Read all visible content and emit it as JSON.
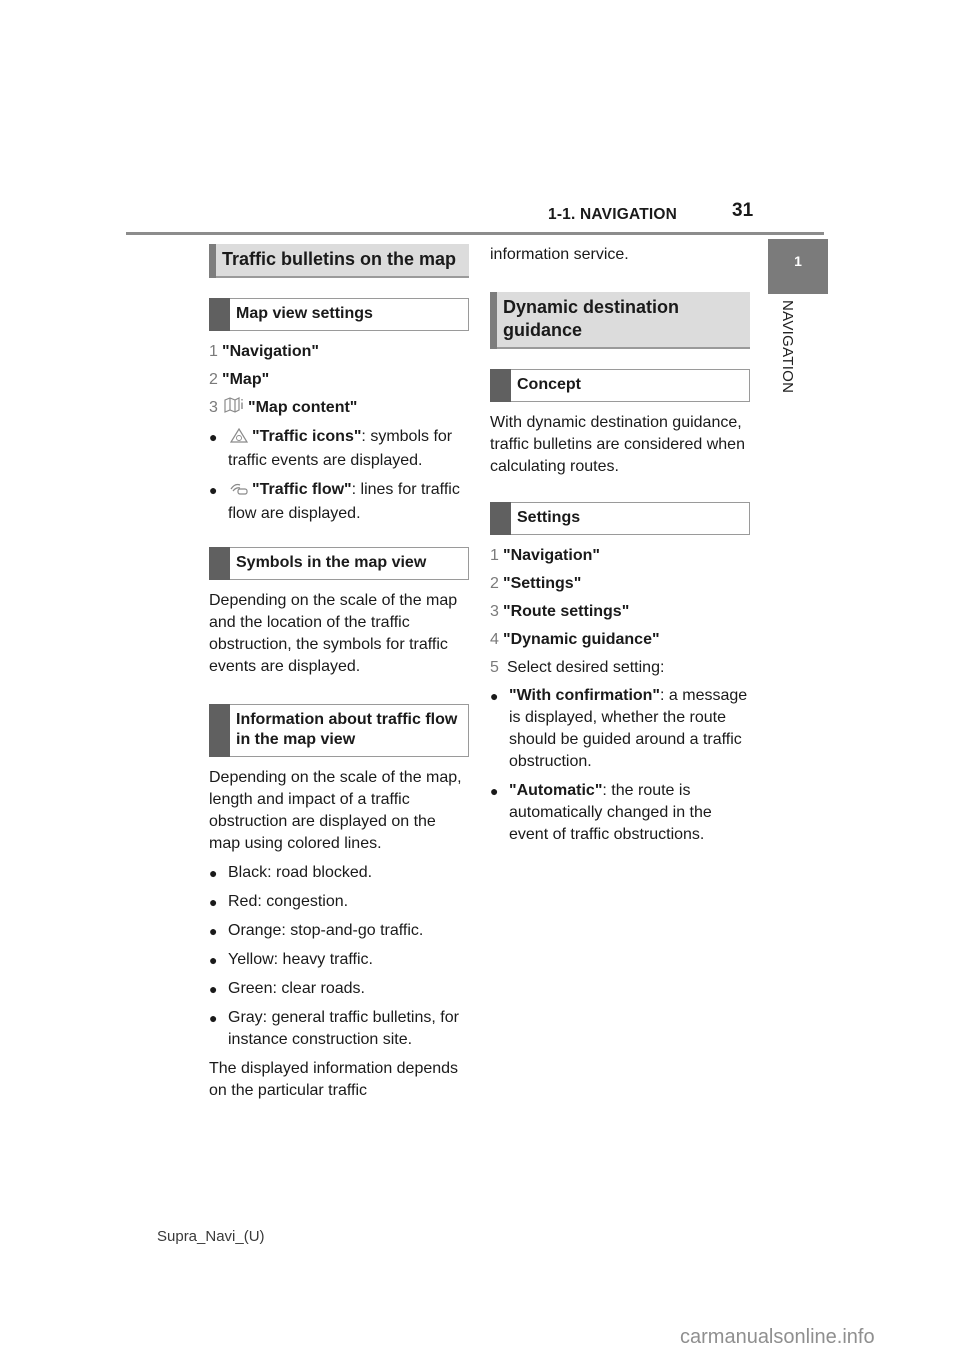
{
  "header": {
    "section_title": "1-1. NAVIGATION",
    "page_number": "31"
  },
  "side_tab": {
    "chapter_number": "1",
    "chapter_label": "NAVIGATION"
  },
  "left_column": {
    "heading": "Traffic bulletins on the map",
    "map_view_settings": {
      "title": "Map view settings",
      "steps": [
        {
          "num": "1",
          "label": "\"Navigation\""
        },
        {
          "num": "2",
          "label": "\"Map\""
        },
        {
          "num": "3",
          "icon": "map-content-icon",
          "label": "\"Map content\""
        }
      ],
      "bullets": [
        {
          "icon": "traffic-icons-icon",
          "label": "\"Traffic icons\"",
          "text": ": symbols for traffic events are displayed."
        },
        {
          "icon": "traffic-flow-icon",
          "label": "\"Traffic flow\"",
          "text": ": lines for traffic flow are displayed."
        }
      ]
    },
    "symbols": {
      "title": "Symbols in the map view",
      "body": "Depending on the scale of the map and the location of the traffic obstruction, the symbols for traffic events are displayed."
    },
    "flow_info": {
      "title": "Information about traffic flow in the map view",
      "body": "Depending on the scale of the map, length and impact of a traffic obstruction are displayed on the map using colored lines.",
      "colors": [
        "Black: road blocked.",
        "Red: congestion.",
        "Orange: stop-and-go traffic.",
        "Yellow: heavy traffic.",
        "Green: clear roads.",
        "Gray: general traffic bulletins, for instance construction site."
      ],
      "closing": "The displayed information depends on the particular traffic"
    }
  },
  "right_column": {
    "continuation": "information service.",
    "heading": "Dynamic destination guidance",
    "concept": {
      "title": "Concept",
      "body": "With dynamic destination guidance, traffic bulletins are considered when calculating routes."
    },
    "settings": {
      "title": "Settings",
      "steps": [
        {
          "num": "1",
          "label": "\"Navigation\""
        },
        {
          "num": "2",
          "label": "\"Settings\""
        },
        {
          "num": "3",
          "label": "\"Route settings\""
        },
        {
          "num": "4",
          "label": "\"Dynamic guidance\""
        },
        {
          "num": "5",
          "text": "Select desired setting:"
        }
      ],
      "bullets": [
        {
          "label": "\"With confirmation\"",
          "text": ": a message is displayed, whether the route should be guided around a traffic obstruction."
        },
        {
          "label": "\"Automatic\"",
          "text": ": the route is automatically changed in the event of traffic obstructions."
        }
      ]
    }
  },
  "footer": {
    "doc_id": "Supra_Navi_(U)"
  },
  "watermark": "carmanualsonline.info"
}
